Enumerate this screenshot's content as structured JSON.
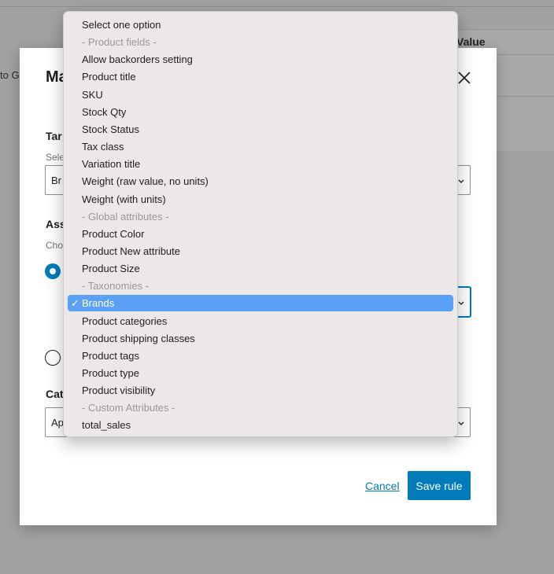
{
  "background": {
    "column_header": "Value",
    "left_text": "to Ge"
  },
  "modal": {
    "title": "Ma",
    "target_label": "Tar",
    "target_help": "Sele",
    "target_value": "Br",
    "assign_label": "Ass",
    "assign_help": "Cho",
    "category_label": "Cat",
    "category_value": "Ap",
    "cancel_label": "Cancel",
    "save_label": "Save rule"
  },
  "dropdown": {
    "selected_index": 16,
    "options": [
      {
        "label": "Select one option",
        "type": "option"
      },
      {
        "label": "- Product fields -",
        "type": "group"
      },
      {
        "label": "Allow backorders setting",
        "type": "option"
      },
      {
        "label": "Product title",
        "type": "option"
      },
      {
        "label": "SKU",
        "type": "option"
      },
      {
        "label": "Stock Qty",
        "type": "option"
      },
      {
        "label": "Stock Status",
        "type": "option"
      },
      {
        "label": "Tax class",
        "type": "option"
      },
      {
        "label": "Variation title",
        "type": "option"
      },
      {
        "label": "Weight (raw value, no units)",
        "type": "option"
      },
      {
        "label": "Weight (with units)",
        "type": "option"
      },
      {
        "label": "- Global attributes -",
        "type": "group"
      },
      {
        "label": "Product Color",
        "type": "option"
      },
      {
        "label": "Product New attribute",
        "type": "option"
      },
      {
        "label": "Product Size",
        "type": "option"
      },
      {
        "label": "- Taxonomies -",
        "type": "group"
      },
      {
        "label": "Brands",
        "type": "option"
      },
      {
        "label": "Product categories",
        "type": "option"
      },
      {
        "label": "Product shipping classes",
        "type": "option"
      },
      {
        "label": "Product tags",
        "type": "option"
      },
      {
        "label": "Product type",
        "type": "option"
      },
      {
        "label": "Product visibility",
        "type": "option"
      },
      {
        "label": "- Custom Attributes -",
        "type": "group"
      },
      {
        "label": "total_sales",
        "type": "option"
      }
    ]
  },
  "colors": {
    "accent": "#007cba",
    "highlight": "#5aa0f6",
    "overlay": "#a2a2a4"
  }
}
